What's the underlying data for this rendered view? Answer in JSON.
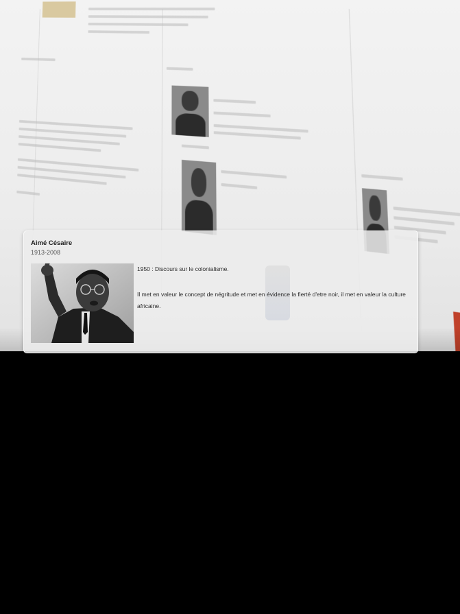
{
  "card": {
    "name": "Aimé Césaire",
    "years": "1913-2008",
    "event": "1950 : Discours sur le colonialisme.",
    "description": "Il met en valeur le concept de négritude et met en évidence la fierté d'etre noir, il met en valeur la culture africaine."
  },
  "portrait": {
    "subject_icon": "person-portrait-icon"
  }
}
